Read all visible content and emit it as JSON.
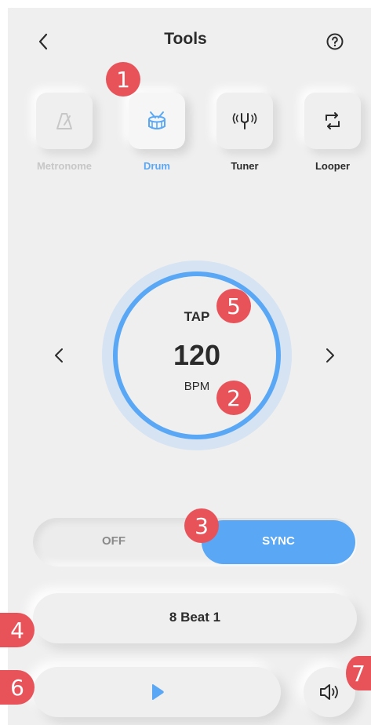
{
  "header": {
    "title": "Tools",
    "back_icon": "chevron-left-icon",
    "help_icon": "help-circle-icon"
  },
  "tools": [
    {
      "label": "Metronome",
      "icon": "metronome-icon",
      "state": "disabled"
    },
    {
      "label": "Drum",
      "icon": "drum-icon",
      "state": "active"
    },
    {
      "label": "Tuner",
      "icon": "tuning-fork-icon",
      "state": "normal"
    },
    {
      "label": "Looper",
      "icon": "loop-icon",
      "state": "normal"
    }
  ],
  "tempo": {
    "tap_label": "TAP",
    "bpm_value": "120",
    "bpm_unit": "BPM"
  },
  "sync_toggle": {
    "off_label": "OFF",
    "on_label": "SYNC",
    "selected": "SYNC"
  },
  "pattern": {
    "name": "8 Beat 1"
  },
  "playback": {
    "play_icon": "play-icon",
    "volume_icon": "speaker-icon"
  },
  "annotations": [
    "1",
    "2",
    "3",
    "4",
    "5",
    "6",
    "7"
  ],
  "colors": {
    "accent": "#5aa8f5",
    "badge": "#e8535a",
    "background": "#efefef",
    "disabled": "#c7c7c7",
    "text": "#2b2b2b"
  }
}
